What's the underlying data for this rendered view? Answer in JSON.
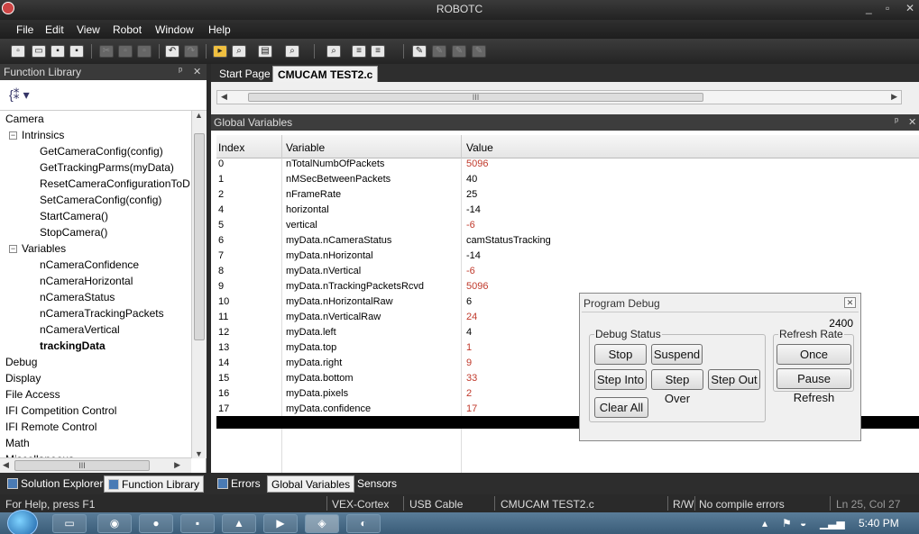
{
  "window": {
    "title": "ROBOTC",
    "minimize": "_",
    "restore": "▫",
    "close": "✕"
  },
  "menu": {
    "items": [
      "File",
      "Edit",
      "View",
      "Robot",
      "Window",
      "Help"
    ]
  },
  "function_library": {
    "title": "Function Library",
    "pin": "ᵖ",
    "close": "✕",
    "tree": [
      {
        "label": "Camera",
        "level": 0
      },
      {
        "label": "Intrinsics",
        "level": 1,
        "toggle": "−"
      },
      {
        "label": "GetCameraConfig(config)",
        "level": 2
      },
      {
        "label": "GetTrackingParms(myData)",
        "level": 2
      },
      {
        "label": "ResetCameraConfigurationToD",
        "level": 2
      },
      {
        "label": "SetCameraConfig(config)",
        "level": 2
      },
      {
        "label": "StartCamera()",
        "level": 2
      },
      {
        "label": "StopCamera()",
        "level": 2
      },
      {
        "label": "Variables",
        "level": 1,
        "toggle": "−"
      },
      {
        "label": "nCameraConfidence",
        "level": 2
      },
      {
        "label": "nCameraHorizontal",
        "level": 2
      },
      {
        "label": "nCameraStatus",
        "level": 2
      },
      {
        "label": "nCameraTrackingPackets",
        "level": 2
      },
      {
        "label": "nCameraVertical",
        "level": 2
      },
      {
        "label": "trackingData",
        "level": 2,
        "bold": true
      },
      {
        "label": "Debug",
        "level": 0
      },
      {
        "label": "Display",
        "level": 0
      },
      {
        "label": "File Access",
        "level": 0
      },
      {
        "label": "IFI Competition Control",
        "level": 0
      },
      {
        "label": "IFI Remote Control",
        "level": 0
      },
      {
        "label": "Math",
        "level": 0
      },
      {
        "label": "Miscellaneous",
        "level": 0
      }
    ],
    "hscroll_grip": "III"
  },
  "editor_tabs": {
    "items": [
      "Start Page",
      "CMUCAM TEST2.c"
    ],
    "active": 1,
    "scroll_grip": "III"
  },
  "global_variables": {
    "title": "Global Variables",
    "columns": [
      "Index",
      "Variable",
      "Value"
    ],
    "rows": [
      {
        "index": "0",
        "variable": "nTotalNumbOfPackets",
        "value": "5096",
        "changed": true
      },
      {
        "index": "1",
        "variable": "nMSecBetweenPackets",
        "value": "40",
        "changed": false
      },
      {
        "index": "2",
        "variable": "nFrameRate",
        "value": "25",
        "changed": false
      },
      {
        "index": "4",
        "variable": "horizontal",
        "value": "-14",
        "changed": false
      },
      {
        "index": "5",
        "variable": "vertical",
        "value": "-6",
        "changed": true
      },
      {
        "index": "6",
        "variable": "myData.nCameraStatus",
        "value": "camStatusTracking",
        "changed": false
      },
      {
        "index": "7",
        "variable": "myData.nHorizontal",
        "value": "-14",
        "changed": false
      },
      {
        "index": "8",
        "variable": "myData.nVertical",
        "value": "-6",
        "changed": true
      },
      {
        "index": "9",
        "variable": "myData.nTrackingPacketsRcvd",
        "value": "5096",
        "changed": true
      },
      {
        "index": "10",
        "variable": "myData.nHorizontalRaw",
        "value": "6",
        "changed": false
      },
      {
        "index": "11",
        "variable": "myData.nVerticalRaw",
        "value": "24",
        "changed": true
      },
      {
        "index": "12",
        "variable": "myData.left",
        "value": "4",
        "changed": false
      },
      {
        "index": "13",
        "variable": "myData.top",
        "value": "1",
        "changed": true
      },
      {
        "index": "14",
        "variable": "myData.right",
        "value": "9",
        "changed": true
      },
      {
        "index": "15",
        "variable": "myData.bottom",
        "value": "33",
        "changed": true
      },
      {
        "index": "16",
        "variable": "myData.pixels",
        "value": "2",
        "changed": true
      },
      {
        "index": "17",
        "variable": "myData.confidence",
        "value": "17",
        "changed": true
      }
    ]
  },
  "program_debug": {
    "title": "Program Debug",
    "close": "✕",
    "counter": "2400",
    "debug_status_label": "Debug Status",
    "refresh_rate_label": "Refresh Rate",
    "buttons": {
      "stop": "Stop",
      "suspend": "Suspend",
      "step_into": "Step Into",
      "step_over": "Step Over",
      "step_out": "Step Out",
      "clear_all": "Clear All",
      "once": "Once",
      "pause_refresh": "Pause Refresh"
    }
  },
  "bottom_tabs": {
    "left": [
      {
        "label": "Solution Explorer"
      },
      {
        "label": "Function Library",
        "active": true
      }
    ],
    "right": [
      {
        "label": "Errors"
      },
      {
        "label": "Global Variables",
        "active": true
      },
      {
        "label": "Sensors"
      }
    ]
  },
  "status_bar": {
    "help": "For Help, press F1",
    "platform": "VEX-Cortex",
    "connection": "USB Cable",
    "file": "CMUCAM TEST2.c",
    "mode": "R/W",
    "compile": "No compile errors",
    "position": "Ln 25, Col 27"
  },
  "taskbar": {
    "clock": "5:40 PM"
  },
  "colors": {
    "changed_value": "#c0392b",
    "dark_chrome": "#2a2a2a"
  }
}
